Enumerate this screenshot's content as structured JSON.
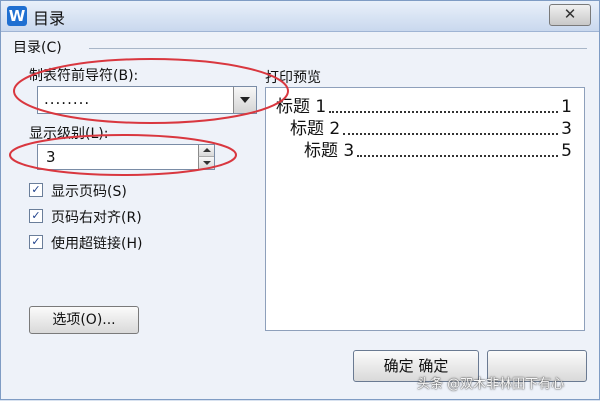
{
  "window": {
    "title": "目录",
    "app_icon_letter": "W",
    "close_symbol": "✕"
  },
  "section": {
    "label": "目录(C)"
  },
  "leader": {
    "label": "制表符前导符(B):",
    "value": "........"
  },
  "levels": {
    "label": "显示级别(L):",
    "value": "3"
  },
  "checkboxes": [
    {
      "label": "显示页码(S)",
      "checked": true
    },
    {
      "label": "页码右对齐(R)",
      "checked": true
    },
    {
      "label": "使用超链接(H)",
      "checked": true
    }
  ],
  "options_button": {
    "label": "选项(O)..."
  },
  "preview": {
    "label": "打印预览",
    "entries": [
      {
        "title": "标题 1",
        "page": "1"
      },
      {
        "title": "标题 2",
        "page": "3"
      },
      {
        "title": "标题 3",
        "page": "5"
      }
    ]
  },
  "ok_button": {
    "label": "确定 确定"
  },
  "watermark": "头条 @双木非林田下有心",
  "colors": {
    "annotation_red": "#d9373f",
    "accent_blue": "#1f6fd1"
  }
}
